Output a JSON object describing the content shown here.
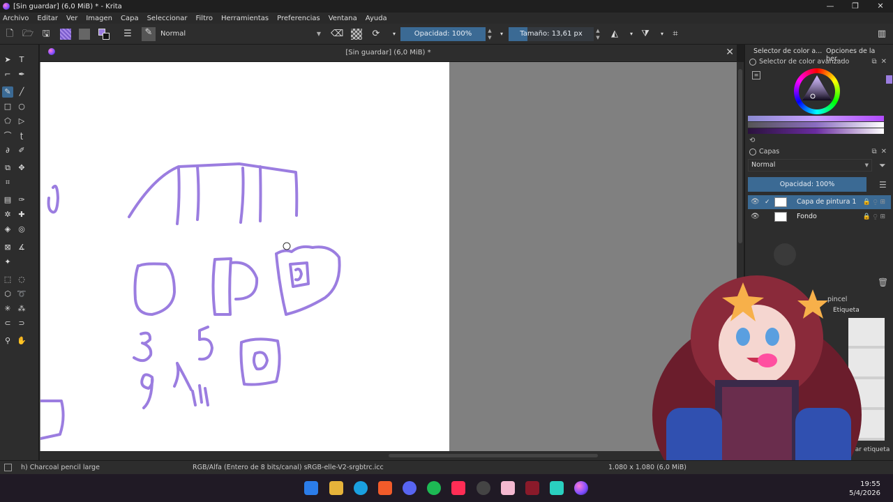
{
  "window": {
    "title": "[Sin guardar]  (6,0 MiB) * - Krita",
    "controls": [
      "—",
      "❐",
      "✕"
    ]
  },
  "menu": [
    "Archivo",
    "Editar",
    "Ver",
    "Imagen",
    "Capa",
    "Seleccionar",
    "Filtro",
    "Herramientas",
    "Preferencias",
    "Ventana",
    "Ayuda"
  ],
  "toolbar": {
    "blend_mode": "Normal",
    "opacity": "Opacidad: 100%",
    "size": "Tamaño: 13,61 px"
  },
  "canvas": {
    "tab_title": "[Sin guardar]  (6,0 MiB) *",
    "stroke_color": "#9b7de0",
    "background": "#808080"
  },
  "dockers": {
    "tab_1": "Selector de color a...",
    "tab_2": "Opciones de la her...",
    "color_selector_title": "Selector de color avanzado",
    "layers_title": "Capas",
    "layers_blend": "Normal",
    "layers_opacity": "Opacidad:  100%",
    "layers": [
      {
        "name": "Capa de pintura 1",
        "active": true
      },
      {
        "name": "Fondo",
        "active": false
      }
    ],
    "brush_panel_title": "pincel",
    "brush_tag_label": "Etiqueta",
    "brush_tag_filter": "rar etiqueta"
  },
  "status": {
    "brush": "h) Charcoal pencil large",
    "color_profile": "RGB/Alfa (Entero de 8 bits/canal)  sRGB-elle-V2-srgbtrc.icc",
    "dimensions": "1.080 x 1.080 (6,0 MiB)"
  },
  "taskbar": {
    "time": "19:55",
    "date": "5/4/2026"
  },
  "colors": {
    "accent": "#3b6a94",
    "panel": "#2d2d2d",
    "stroke": "#9b7de0"
  }
}
